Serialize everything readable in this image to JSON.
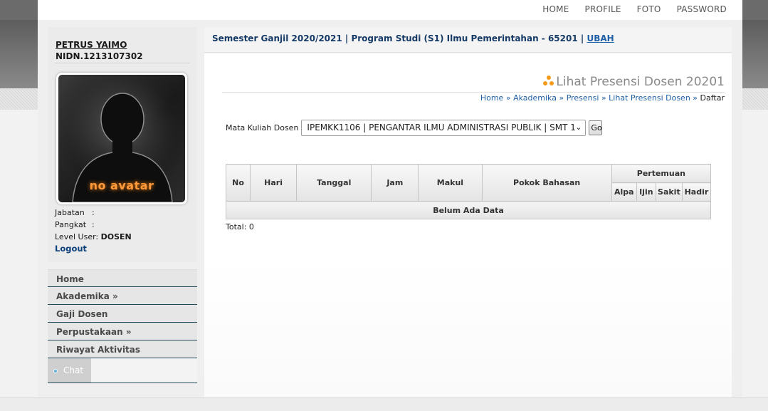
{
  "topnav": {
    "items": [
      "HOME",
      "PROFILE",
      "FOTO",
      "PASSWORD"
    ]
  },
  "profile": {
    "name": "PETRUS YAIMO",
    "nidn": "NIDN.1213107302",
    "avatar_text": "no avatar",
    "jabatan_label": "Jabatan",
    "jabatan_value": ":",
    "pangkat_label": "Pangkat",
    "pangkat_value": ":",
    "level_label": "Level User:",
    "level_value": "DOSEN",
    "logout": "Logout"
  },
  "sidebar_menu": {
    "items": [
      "Home",
      "Akademika »",
      "Gaji Dosen",
      "Perpustakaan »",
      "Riwayat Aktivitas"
    ],
    "chat": "Chat"
  },
  "header": {
    "semester_text": "Semester Ganjil 2020/2021 | Program Studi (S1) Ilmu Pemerintahan - 65201 |",
    "univ_link": "UBAH"
  },
  "main": {
    "title": "Lihat Presensi Dosen 20201",
    "breadcrumb": [
      "Home",
      "Akademika",
      "Presensi",
      "Lihat Presensi Dosen"
    ],
    "breadcrumb_sep": " » ",
    "breadcrumb_current": "Daftar",
    "filter_label": "Mata Kuliah Dosen",
    "filter_selected": "IPEMKK1106 | PENGANTAR ILMU ADMINISTRASI PUBLIK | SMT 1",
    "go_label": "Go",
    "table": {
      "headers": [
        "No",
        "Hari",
        "Tanggal",
        "Jam",
        "Makul",
        "Pokok Bahasan"
      ],
      "group_header": "Pertemuan",
      "sub_headers": [
        "Alpa",
        "Ijin",
        "Sakit",
        "Hadir"
      ],
      "empty_text": "Belum Ada Data"
    },
    "total": "Total: 0"
  },
  "colors": {
    "accent": "#f59a1a",
    "link": "#1f5fa5",
    "header_text": "#163a66",
    "menu_rule": "#214a5a"
  }
}
